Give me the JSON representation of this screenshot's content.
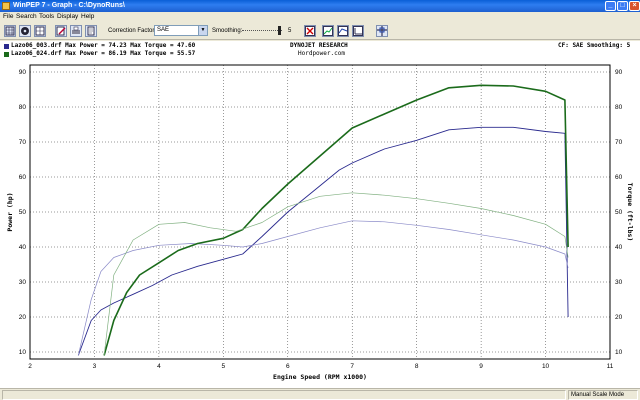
{
  "window": {
    "title": "WinPEP 7  -  Graph - C:\\DynoRuns\\"
  },
  "menu": [
    "File",
    "Search",
    "Tools",
    "Display",
    "Help"
  ],
  "toolbar": {
    "correction_factor_label": "Correction Factor:",
    "correction_factor_value": "SAE",
    "smoothing_label": "Smoothing:",
    "smoothing_value": "5"
  },
  "header": {
    "run1": "Lazo06_003.drf Max Power = 74.23 Max Torque = 47.60",
    "run2": "Lazo06_024.drf Max Power = 86.19 Max Torque = 55.57",
    "center_line1": "DYNOJET RESEARCH",
    "center_line2": "Hordpower.com",
    "right": "CF: SAE  Smoothing: 5"
  },
  "colors": {
    "run1": "#2a2a8e",
    "run1_torque": "#8a8ac8",
    "run2": "#1b6b1b",
    "run2_torque": "#80b080"
  },
  "chart_data": {
    "type": "line",
    "xlabel": "Engine Speed (RPM x1000)",
    "ylabel": "Power (hp)",
    "y2label": "Torque (ft-lbs)",
    "xlim": [
      2,
      11
    ],
    "ylim": [
      8,
      92
    ],
    "xticks": [
      2,
      3,
      4,
      5,
      6,
      7,
      8,
      9,
      10,
      11
    ],
    "yticks": [
      10,
      20,
      30,
      40,
      50,
      60,
      70,
      80,
      90
    ],
    "grid": true,
    "series": [
      {
        "name": "Lazo06_003.drf",
        "role": "power",
        "color_key": "run1",
        "x": [
          2.75,
          2.95,
          3.1,
          3.3,
          3.6,
          3.9,
          4.2,
          4.6,
          5.0,
          5.3,
          5.6,
          6.0,
          6.4,
          6.8,
          7.0,
          7.5,
          8.0,
          8.5,
          9.0,
          9.5,
          10.0,
          10.3,
          10.35
        ],
        "y": [
          9,
          19,
          22,
          24,
          26.5,
          29,
          32,
          34.5,
          36.5,
          38,
          43,
          50,
          56,
          62,
          64,
          68,
          70.5,
          73.5,
          74.2,
          74.2,
          73,
          72.5,
          20
        ]
      },
      {
        "name": "Lazo06_003.drf",
        "role": "torque",
        "color_key": "run1_torque",
        "x": [
          2.75,
          2.95,
          3.1,
          3.3,
          3.6,
          4.0,
          4.5,
          5.0,
          5.3,
          5.6,
          6.0,
          6.5,
          7.0,
          7.5,
          8.0,
          8.5,
          9.0,
          9.5,
          10.0,
          10.3,
          10.35
        ],
        "y": [
          9,
          25,
          33,
          37,
          39,
          40.5,
          41,
          40.5,
          40,
          41,
          43,
          45.5,
          47.5,
          47.2,
          46.2,
          45,
          43.5,
          42,
          40,
          38,
          34
        ]
      },
      {
        "name": "Lazo06_024.drf",
        "role": "power",
        "color_key": "run2",
        "x": [
          3.15,
          3.3,
          3.5,
          3.7,
          4.0,
          4.3,
          4.6,
          5.0,
          5.3,
          5.6,
          6.0,
          6.5,
          7.0,
          7.5,
          8.0,
          8.5,
          9.0,
          9.5,
          10.0,
          10.3,
          10.35
        ],
        "y": [
          9,
          19,
          27,
          32,
          35.5,
          39,
          41,
          42.5,
          45,
          51,
          58,
          66,
          74,
          78,
          82,
          85.5,
          86.2,
          86,
          84.5,
          82,
          40
        ]
      },
      {
        "name": "Lazo06_024.drf",
        "role": "torque",
        "color_key": "run2_torque",
        "x": [
          3.15,
          3.3,
          3.6,
          4.0,
          4.4,
          4.8,
          5.2,
          5.6,
          6.0,
          6.5,
          7.0,
          7.5,
          8.0,
          8.5,
          9.0,
          9.5,
          10.0,
          10.3,
          10.35
        ],
        "y": [
          9,
          32,
          42,
          46.5,
          47,
          45.5,
          44.5,
          47,
          51.5,
          54.5,
          55.5,
          54.8,
          53.8,
          52.5,
          51,
          49,
          46.5,
          43,
          37
        ]
      }
    ]
  },
  "status": {
    "left": "",
    "right": "Manual Scale Mode"
  }
}
